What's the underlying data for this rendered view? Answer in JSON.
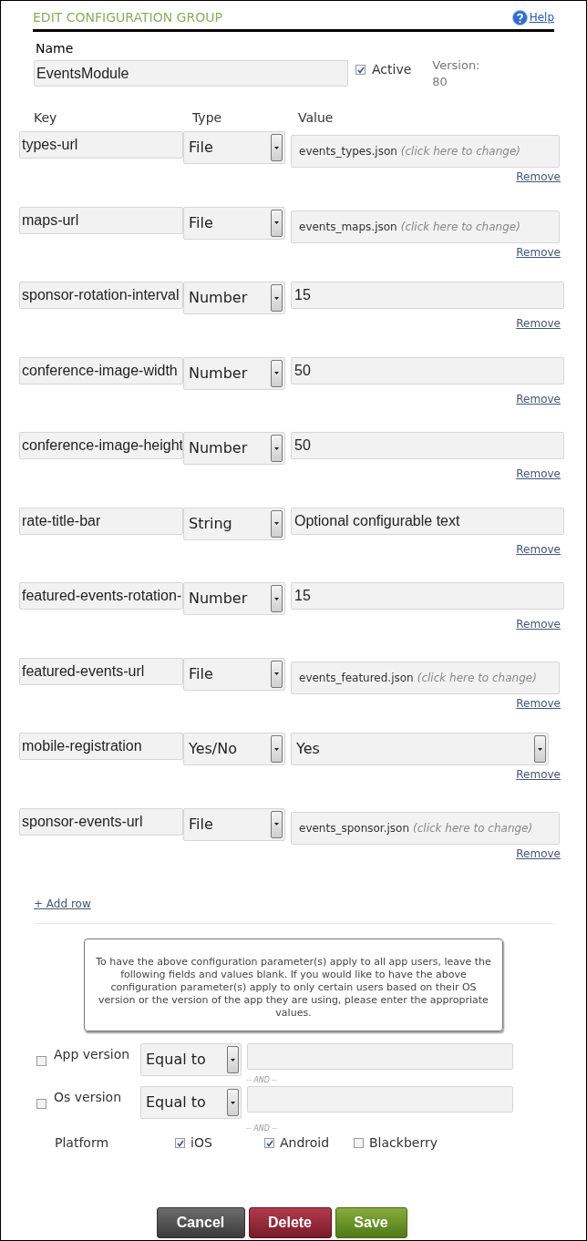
{
  "header": {
    "title": "EDIT CONFIGURATION GROUP",
    "help": "Help"
  },
  "name": {
    "label": "Name",
    "value": "EventsModule"
  },
  "active": {
    "label": "Active",
    "checked": true
  },
  "version": {
    "label": "Version:",
    "value": "80"
  },
  "columns": [
    "Key",
    "Type",
    "Value"
  ],
  "rows": [
    {
      "key": "types-url",
      "type": "File",
      "kind": "file",
      "value": "events_types.json",
      "hint": "(click here to change)",
      "remove": "Remove"
    },
    {
      "key": "maps-url",
      "type": "File",
      "kind": "file",
      "value": "events_maps.json",
      "hint": "(click here to change)",
      "remove": "Remove"
    },
    {
      "key": "sponsor-rotation-interval",
      "type": "Number",
      "kind": "text",
      "value": "15",
      "remove": "Remove"
    },
    {
      "key": "conference-image-width",
      "type": "Number",
      "kind": "text",
      "value": "50",
      "remove": "Remove"
    },
    {
      "key": "conference-image-height",
      "type": "Number",
      "kind": "text",
      "value": "50",
      "remove": "Remove"
    },
    {
      "key": "rate-title-bar",
      "type": "String",
      "kind": "text",
      "value": "Optional configurable text",
      "remove": "Remove"
    },
    {
      "key": "featured-events-rotation-",
      "type": "Number",
      "kind": "text",
      "value": "15",
      "remove": "Remove"
    },
    {
      "key": "featured-events-url",
      "type": "File",
      "kind": "file",
      "value": "events_featured.json",
      "hint": "(click here to change)",
      "remove": "Remove"
    },
    {
      "key": "mobile-registration",
      "type": "Yes/No",
      "kind": "select",
      "value": "Yes",
      "remove": "Remove"
    },
    {
      "key": "sponsor-events-url",
      "type": "File",
      "kind": "file",
      "value": "events_sponsor.json",
      "hint": "(click here to change)",
      "remove": "Remove"
    }
  ],
  "add_row": "+ Add row",
  "note": "To have the above configuration parameter(s) apply to all app users, leave the following fields and values blank. If you would like to have the above configuration parameter(s) apply to only certain users based on their OS version or the version of the app they are using, please enter the appropriate values.",
  "filters": [
    {
      "label": "App version",
      "checked": false,
      "operator": "Equal to"
    },
    {
      "label": "Os version",
      "checked": false,
      "operator": "Equal to",
      "separator": "-- AND --"
    }
  ],
  "platform": {
    "label": "Platform",
    "separator": "-- AND --",
    "options": [
      {
        "label": "iOS",
        "checked": true
      },
      {
        "label": "Android",
        "checked": true
      },
      {
        "label": "Blackberry",
        "checked": false
      }
    ]
  },
  "buttons": [
    {
      "label": "Cancel",
      "kind": "cancel"
    },
    {
      "label": "Delete",
      "kind": "delete"
    },
    {
      "label": "Save",
      "kind": "save"
    }
  ]
}
